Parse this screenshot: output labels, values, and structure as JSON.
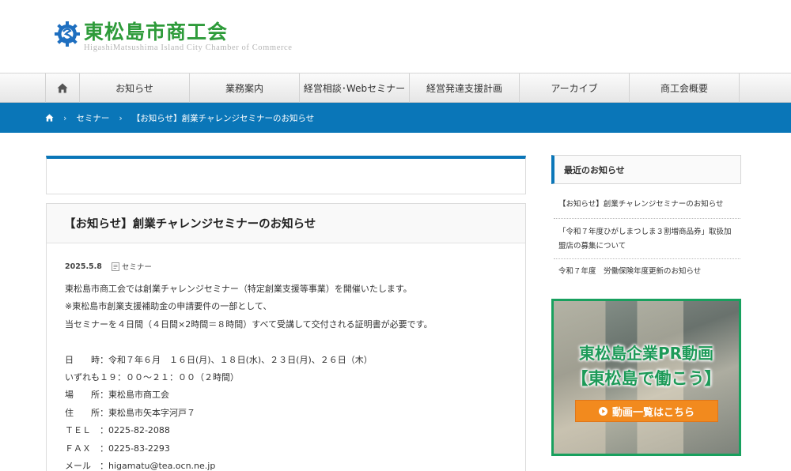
{
  "header": {
    "logo_title": "東松島市商工会",
    "logo_subtitle": "HigashiMatsushima Island City Chamber of Commerce"
  },
  "nav": {
    "items": [
      {
        "label": "お知らせ"
      },
      {
        "label": "業務案内"
      },
      {
        "label": "経営相談･Webセミナー"
      },
      {
        "label": "経営発達支援計画"
      },
      {
        "label": "アーカイブ"
      },
      {
        "label": "商工会概要"
      }
    ]
  },
  "breadcrumb": {
    "sep": "›",
    "items": [
      "セミナー",
      "【お知らせ】創業チャレンジセミナーのお知らせ"
    ]
  },
  "post": {
    "title": "【お知らせ】創業チャレンジセミナーのお知らせ",
    "date": "2025.5.8",
    "category": "セミナー",
    "lines": [
      "東松島市商工会では創業チャレンジセミナー（特定創業支援等事業）を開催いたします。",
      "※東松島市創業支援補助金の申請要件の一部として、",
      "当セミナーを４日間（４日間×2時間＝８時間）すべて受講して交付される証明書が必要です。",
      "",
      "日　　時：令和７年６月　１６日(月)、１８日(水)、２３日(月)、２６日（木）",
      "いずれも１９：００〜２１：００（２時間）",
      "場　　所：東松島市商工会",
      "住　　所：東松島市矢本字河戸７",
      "ＴＥＬ　：0225-82-2088",
      "ＦＡＸ　：0225-83-2293",
      "メール　：higamatu@tea.ocn.ne.jp"
    ]
  },
  "sidebar": {
    "heading": "最近のお知らせ",
    "items": [
      "【お知らせ】創業チャレンジセミナーのお知らせ",
      "「令和７年度ひがしまつしま３割増商品券」取扱加盟店の募集について",
      "令和７年度　労働保険年度更新のお知らせ"
    ],
    "banner": {
      "line1": "東松島企業PR動画",
      "line2": "【東松島で働こう】",
      "button": "動画一覧はこちら"
    }
  },
  "colors": {
    "brand_blue": "#0a76b8",
    "logo_green": "#2e9b3a",
    "banner_green": "#1d9a58",
    "banner_orange": "#f28a1e"
  }
}
